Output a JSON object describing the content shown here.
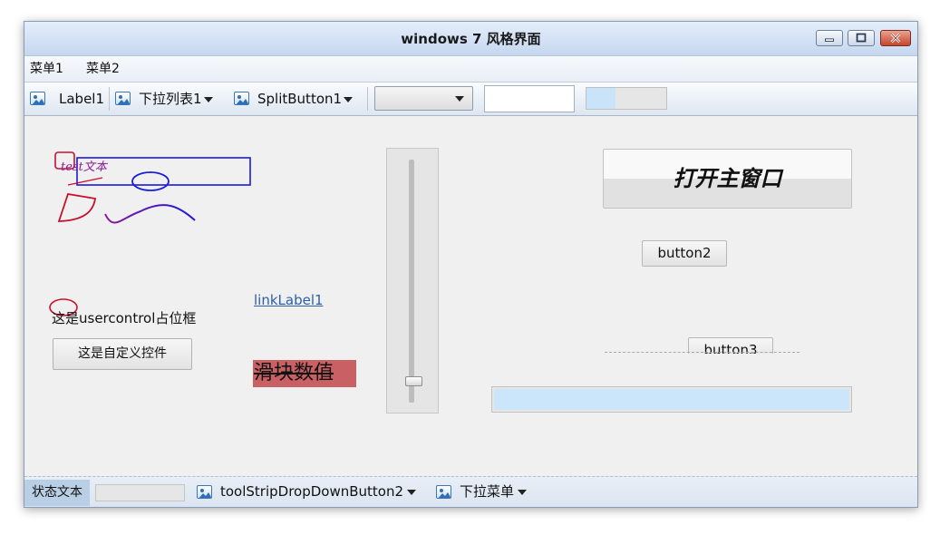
{
  "window": {
    "title": "windows 7 风格界面"
  },
  "menu": {
    "items": [
      "菜单1",
      "菜单2"
    ]
  },
  "toolbar": {
    "label1": "Label1",
    "dropdown1": "下拉列表1",
    "split_button": "SplitButton1",
    "combo_value": "",
    "textbox_value": "",
    "progress": 0.36
  },
  "content": {
    "painted_text": "test文本",
    "link_label": "linkLabel1",
    "usercontrol_placeholder": "这是usercontrol占位框",
    "custom_control_button": "这是自定义控件",
    "slider_value_label": "滑块数值",
    "trackbar_value": 0.07,
    "open_main_button": "打开主窗口",
    "button2": "button2",
    "button3": "button3",
    "progress": 1.0
  },
  "statusbar": {
    "status_text": "状态文本",
    "progress": 0.0,
    "dropdown_button": "toolStripDropDownButton2",
    "dropdown_menu": "下拉菜单"
  },
  "colors": {
    "title_gradient": "#c5d7ef",
    "close_button": "#c6452a",
    "link": "#2d5ea8",
    "slider_label_bg": "#c96064",
    "progress_fill": "#cbe6fb",
    "drawing_red": "#c8102e",
    "drawing_blue": "#1a1adc",
    "drawing_purple": "#8a1a9a"
  },
  "icons": {
    "toolbar_item_icon": "image-icon",
    "caption_buttons": [
      "minimize-icon",
      "maximize-icon",
      "close-icon"
    ],
    "dropdown_arrow": "triangle-down-icon"
  }
}
